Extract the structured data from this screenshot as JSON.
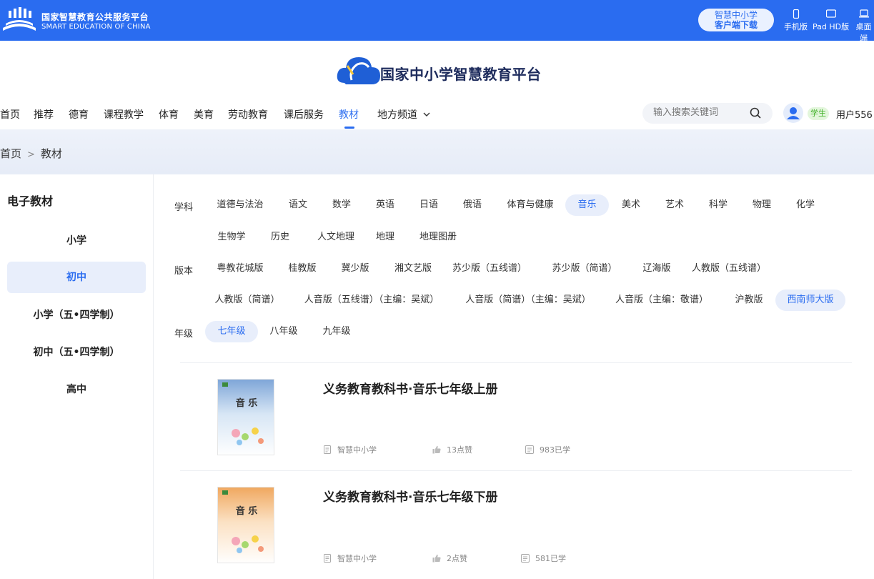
{
  "header": {
    "title": "国家智慧教育公共服务平台",
    "subtitle": "SMART EDUCATION OF CHINA",
    "download": {
      "line1": "智慧中小学",
      "line2": "客户端下载"
    },
    "devices": [
      "手机版",
      "Pad HD版",
      "桌面端"
    ]
  },
  "brand": {
    "name": "国家中小学智慧教育平台"
  },
  "nav": {
    "items": [
      "首页",
      "推荐",
      "德育",
      "课程教学",
      "体育",
      "美育",
      "劳动教育",
      "课后服务",
      "教材",
      "地方频道"
    ],
    "active": "教材",
    "search_placeholder": "输入搜索关键词",
    "role": "学生",
    "username": "用户556"
  },
  "breadcrumb": {
    "home": "首页",
    "sep": ">",
    "current": "教材"
  },
  "sidebar": {
    "title": "电子教材",
    "items": [
      "小学",
      "初中",
      "小学（五•四学制）",
      "初中（五•四学制）",
      "高中"
    ],
    "active": "初中"
  },
  "filters": {
    "subject_label": "学科",
    "subjects": [
      "道德与法治",
      "语文",
      "数学",
      "英语",
      "日语",
      "俄语",
      "体育与健康",
      "音乐",
      "美术",
      "艺术",
      "科学",
      "物理",
      "化学",
      "生物学",
      "历史",
      "人文地理",
      "地理",
      "地理图册"
    ],
    "subject_active": "音乐",
    "edition_label": "版本",
    "editions": [
      "粤教花城版",
      "桂教版",
      "冀少版",
      "湘文艺版",
      "苏少版（五线谱）",
      "苏少版（简谱）",
      "辽海版",
      "人教版（五线谱）",
      "人教版（简谱）",
      "人音版（五线谱）（主编：吴斌）",
      "人音版（简谱）（主编：吴斌）",
      "人音版（主编：敬谱）",
      "沪教版",
      "西南师大版"
    ],
    "edition_active": "西南师大版",
    "grade_label": "年级",
    "grades": [
      "七年级",
      "八年级",
      "九年级"
    ],
    "grade_active": "七年级"
  },
  "books": [
    {
      "title": "义务教育教科书·音乐七年级上册",
      "publisher": "智慧中小学",
      "likes": "13点赞",
      "learned": "983已学",
      "cover_word": "音 乐",
      "cover_color": "#7fa6d8"
    },
    {
      "title": "义务教育教科书·音乐七年级下册",
      "publisher": "智慧中小学",
      "likes": "2点赞",
      "learned": "581已学",
      "cover_word": "音 乐",
      "cover_color": "#f0a860"
    }
  ],
  "colors": {
    "primary": "#2a6cf0",
    "active_bg": "#e8eefb",
    "badge_green": "#3fb026"
  }
}
